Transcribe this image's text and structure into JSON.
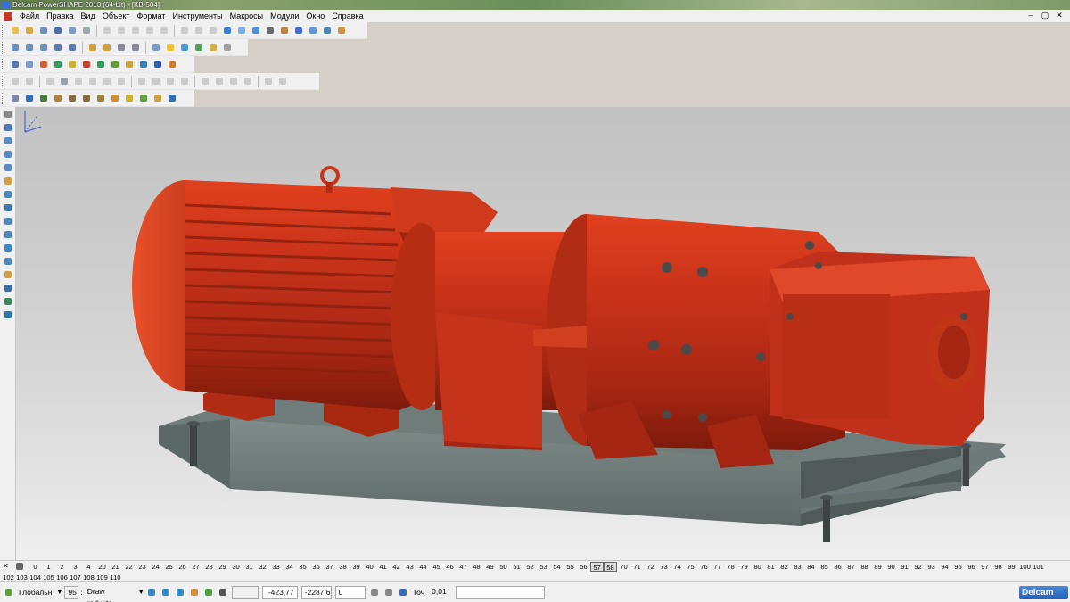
{
  "window": {
    "title": "Delcam PowerSHAPE 2013 (64-bit) - [KB-504]",
    "controls": [
      "–",
      "▢",
      "✕"
    ]
  },
  "menu": {
    "items": [
      "Файл",
      "Правка",
      "Вид",
      "Объект",
      "Формат",
      "Инструменты",
      "Макросы",
      "Модули",
      "Окно",
      "Справка"
    ]
  },
  "levels": {
    "row1": [
      "0",
      "1",
      "2",
      "3",
      "4",
      "20",
      "21",
      "22",
      "23",
      "24",
      "25",
      "26",
      "27",
      "28",
      "29",
      "30",
      "31",
      "32",
      "33",
      "34",
      "35",
      "36",
      "37",
      "38",
      "39",
      "40",
      "41",
      "42",
      "43",
      "44",
      "45",
      "46",
      "47",
      "48",
      "49",
      "50",
      "51",
      "52",
      "53",
      "54",
      "55",
      "56",
      "57",
      "58",
      "70",
      "71",
      "72",
      "73",
      "74",
      "75",
      "76",
      "77",
      "78",
      "79",
      "80",
      "81",
      "82",
      "83",
      "84",
      "85",
      "86",
      "87",
      "88",
      "89",
      "90",
      "91",
      "92",
      "93",
      "94",
      "95",
      "96",
      "97",
      "98",
      "99",
      "100",
      "101"
    ],
    "row2": [
      "102",
      "103",
      "104",
      "105",
      "106",
      "107",
      "108",
      "109",
      "110"
    ],
    "boxed": [
      "57",
      "58"
    ]
  },
  "status": {
    "workplane": "Глобальн",
    "level_number": "95",
    "level_name": "Draw reduktc",
    "x": "-423,77",
    "y": "-2287,6",
    "z": "0",
    "tolerance_label": "Точ",
    "tolerance": "0,01",
    "logo": "Delcam"
  }
}
